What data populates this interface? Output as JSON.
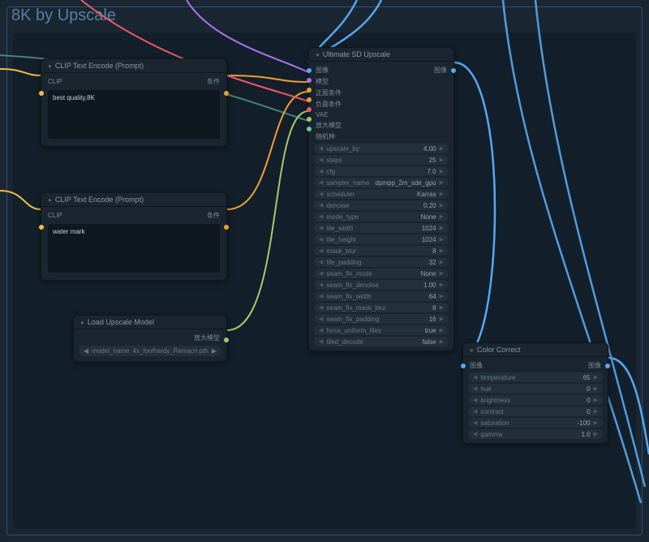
{
  "group_title": "8K by Upscale",
  "clip1": {
    "title": "CLIP Text Encode (Prompt)",
    "in_clip": "CLIP",
    "out": "条件",
    "text": "best quality,8K"
  },
  "clip2": {
    "title": "CLIP Text Encode (Prompt)",
    "in_clip": "CLIP",
    "out": "条件",
    "text": "water mark"
  },
  "load_upscale": {
    "title": "Load Upscale Model",
    "out": "放大模型",
    "param_label": "model_name",
    "param_value": "4x_foolhardy_Remacri.pth"
  },
  "usd": {
    "title": "Ultimate SD Upscale",
    "in": [
      "图像",
      "模型",
      "正面条件",
      "负面条件",
      "VAE",
      "放大模型",
      "随机种"
    ],
    "out": "图像",
    "params": [
      {
        "label": "upscale_by",
        "value": "4.00"
      },
      {
        "label": "steps",
        "value": "25"
      },
      {
        "label": "cfg",
        "value": "7.0"
      },
      {
        "label": "sampler_name",
        "value": "dpmpp_2m_sde_gpu"
      },
      {
        "label": "scheduler",
        "value": "Karras"
      },
      {
        "label": "denoise",
        "value": "0.20"
      },
      {
        "label": "mode_type",
        "value": "None"
      },
      {
        "label": "tile_width",
        "value": "1024"
      },
      {
        "label": "tile_height",
        "value": "1024"
      },
      {
        "label": "mask_blur",
        "value": "8"
      },
      {
        "label": "tile_padding",
        "value": "32"
      },
      {
        "label": "seam_fix_mode",
        "value": "None"
      },
      {
        "label": "seam_fix_denoise",
        "value": "1.00"
      },
      {
        "label": "seam_fix_width",
        "value": "64"
      },
      {
        "label": "seam_fix_mask_blur",
        "value": "8"
      },
      {
        "label": "seam_fix_padding",
        "value": "16"
      },
      {
        "label": "force_uniform_tiles",
        "value": "true"
      },
      {
        "label": "tiled_decode",
        "value": "false"
      }
    ]
  },
  "color_correct": {
    "title": "Color Correct",
    "in": "图像",
    "out": "图像",
    "params": [
      {
        "label": "temperature",
        "value": "65"
      },
      {
        "label": "hue",
        "value": "0"
      },
      {
        "label": "brightness",
        "value": "0"
      },
      {
        "label": "contrast",
        "value": "0"
      },
      {
        "label": "saturation",
        "value": "-100"
      },
      {
        "label": "gamma",
        "value": "1.0"
      }
    ]
  },
  "port_colors": {
    "clip": "#f0c040",
    "cond": "#f0a030",
    "image": "#58a8f0",
    "model": "#b070f0",
    "vae": "#f05868",
    "upscale": "#a8c868",
    "latent": "#68c8a8"
  }
}
